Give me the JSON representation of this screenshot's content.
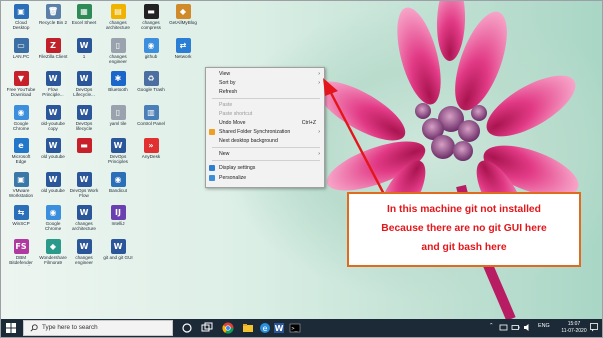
{
  "desktop": {
    "icons": [
      {
        "label": "Cloud Desktop",
        "glyph": "▣",
        "color": "#2a6fb8"
      },
      {
        "label": "Recycle Bin 2",
        "glyph": "🗑",
        "color": "#5a7fa8"
      },
      {
        "label": "Excel Sheet",
        "glyph": "▦",
        "color": "#2e8b57"
      },
      {
        "label": "changes architecture",
        "glyph": "▤",
        "color": "#f0b400"
      },
      {
        "label": "changes compress",
        "glyph": "▬",
        "color": "#222222"
      },
      {
        "label": "GetAllMyBlog",
        "glyph": "◆",
        "color": "#d08a2a"
      },
      {
        "label": "LAN.PC",
        "glyph": "▭",
        "color": "#3a6ea5"
      },
      {
        "label": "FileZilla Client",
        "glyph": "Z",
        "color": "#c0202a"
      },
      {
        "label": "1",
        "glyph": "W",
        "color": "#2b579a"
      },
      {
        "label": "changes engineer",
        "glyph": "▯",
        "color": "#9aa3ad"
      },
      {
        "label": "github",
        "glyph": "◉",
        "color": "#3c8fdd"
      },
      {
        "label": "Network",
        "glyph": "⇄",
        "color": "#2a7fd4"
      },
      {
        "label": "Free YouTube Download",
        "glyph": "▼",
        "color": "#c8202a"
      },
      {
        "label": "Flow Principle...",
        "glyph": "W",
        "color": "#2b579a"
      },
      {
        "label": "DevOps Lifecycle...",
        "glyph": "W",
        "color": "#2b579a"
      },
      {
        "label": "Bluetooth",
        "glyph": "✱",
        "color": "#1b66c9"
      },
      {
        "label": "Google Trash",
        "glyph": "♻",
        "color": "#4a6fa0"
      },
      {
        "label": "Google Chrome",
        "glyph": "◉",
        "color": "#3c8fdd"
      },
      {
        "label": "old-youtube copy",
        "glyph": "W",
        "color": "#2b579a"
      },
      {
        "label": "DevOps lifecycle",
        "glyph": "W",
        "color": "#2b579a"
      },
      {
        "label": "yaml tile",
        "glyph": "▯",
        "color": "#9aa3ad"
      },
      {
        "label": "Control Panel",
        "glyph": "▥",
        "color": "#4a7fb8"
      },
      {
        "label": "Microsoft Edge",
        "glyph": "e",
        "color": "#2277c8"
      },
      {
        "label": "old youtube",
        "glyph": "W",
        "color": "#2b579a"
      },
      {
        "label": "",
        "glyph": "▬",
        "color": "#c8202a"
      },
      {
        "label": "DevOps Principles",
        "glyph": "W",
        "color": "#2b579a"
      },
      {
        "label": "AnyDesk",
        "glyph": "»",
        "color": "#e03030"
      },
      {
        "label": "VMware Workstation",
        "glyph": "▣",
        "color": "#3a78a8"
      },
      {
        "label": "old youtube",
        "glyph": "W",
        "color": "#2b579a"
      },
      {
        "label": "DevOps Work Flow",
        "glyph": "W",
        "color": "#2b579a"
      },
      {
        "label": "Bandicut",
        "glyph": "◉",
        "color": "#2a6fb8"
      },
      {
        "label": "WinSCP",
        "glyph": "⇆",
        "color": "#2a6fb8"
      },
      {
        "label": "Google Chrome",
        "glyph": "◉",
        "color": "#3c8fdd"
      },
      {
        "label": "changes architecture",
        "glyph": "W",
        "color": "#2b579a"
      },
      {
        "label": "IntelliJ",
        "glyph": "IJ",
        "color": "#6a3fb0"
      },
      {
        "label": "DBM Bitdefender Free Studio",
        "glyph": "FS",
        "color": "#b03aa0"
      },
      {
        "label": "Wondershare Filmora9",
        "glyph": "◆",
        "color": "#2a9a8a"
      },
      {
        "label": "changes engineer",
        "glyph": "W",
        "color": "#2b579a"
      },
      {
        "label": "git and git GUI",
        "glyph": "W",
        "color": "#2b579a"
      }
    ]
  },
  "context_menu": {
    "items": [
      {
        "label": "View",
        "shortcut": "",
        "submenu": true,
        "disabled": false
      },
      {
        "label": "Sort by",
        "shortcut": "",
        "submenu": true,
        "disabled": false
      },
      {
        "label": "Refresh",
        "shortcut": "",
        "submenu": false,
        "disabled": false
      },
      {
        "label": "Paste",
        "shortcut": "",
        "submenu": false,
        "disabled": true
      },
      {
        "label": "Paste shortcut",
        "shortcut": "",
        "submenu": false,
        "disabled": true
      },
      {
        "label": "Undo Move",
        "shortcut": "Ctrl+Z",
        "submenu": false,
        "disabled": false
      },
      {
        "label": "Shared Folder Synchronization",
        "shortcut": "",
        "submenu": true,
        "disabled": false
      },
      {
        "label": "Next desktop background",
        "shortcut": "",
        "submenu": false,
        "disabled": false
      },
      {
        "label": "New",
        "shortcut": "",
        "submenu": true,
        "disabled": false
      },
      {
        "label": "Display settings",
        "shortcut": "",
        "submenu": false,
        "disabled": false
      },
      {
        "label": "Personalize",
        "shortcut": "",
        "submenu": false,
        "disabled": false
      }
    ]
  },
  "annotation": {
    "line1": "In this machine git not installed",
    "line2": "Because there are no git GUI here",
    "line3": "and git bash here",
    "text_color": "#e3161b",
    "border_color": "#e06a1e"
  },
  "taskbar": {
    "search_placeholder": "Type here to search",
    "language": "ENG",
    "time": "15:07",
    "date": "11-07-2020",
    "pinned": [
      "cortana-icon",
      "task-view-icon",
      "file-explorer-icon",
      "chrome-icon",
      "edge-icon",
      "word-icon",
      "terminal-icon"
    ]
  }
}
